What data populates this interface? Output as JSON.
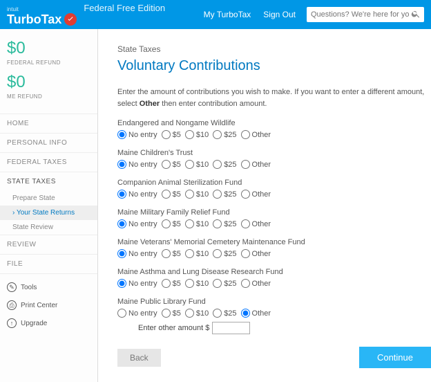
{
  "header": {
    "brand_small": "intuit",
    "brand_name": "TurboTax",
    "edition": "Federal Free Edition",
    "link_myturbotax": "My TurboTax",
    "link_signout": "Sign Out",
    "search_placeholder": "Questions? We're here for you"
  },
  "sidebar": {
    "federal_refund_amt": "$0",
    "federal_refund_label": "FEDERAL REFUND",
    "me_refund_amt": "$0",
    "me_refund_label": "ME REFUND",
    "nav": [
      "HOME",
      "PERSONAL INFO",
      "FEDERAL TAXES",
      "STATE TAXES",
      "REVIEW",
      "FILE"
    ],
    "state_sub": [
      "Prepare State",
      "Your State Returns",
      "State Review"
    ],
    "tools": [
      "Tools",
      "Print Center",
      "Upgrade"
    ]
  },
  "main": {
    "crumb": "State Taxes",
    "title": "Voluntary Contributions",
    "instr_a": "Enter the amount of contributions you wish to make. If you want to enter a different amount, select ",
    "instr_b": "Other",
    "instr_c": " then enter contribution amount.",
    "options": [
      "No entry",
      "$5",
      "$10",
      "$25",
      "Other"
    ],
    "funds": [
      {
        "label": "Endangered and Nongame Wildlife",
        "sel": 0
      },
      {
        "label": "Maine Children's Trust",
        "sel": 0
      },
      {
        "label": "Companion Animal Sterilization Fund",
        "sel": 0
      },
      {
        "label": "Maine Military Family Relief Fund",
        "sel": 0
      },
      {
        "label": "Maine Veterans' Memorial Cemetery Maintenance Fund",
        "sel": 0
      },
      {
        "label": "Maine Asthma and Lung Disease Research Fund",
        "sel": 0
      },
      {
        "label": "Maine Public Library Fund",
        "sel": 4
      }
    ],
    "other_label": "Enter other amount $",
    "back": "Back",
    "continue": "Continue"
  }
}
